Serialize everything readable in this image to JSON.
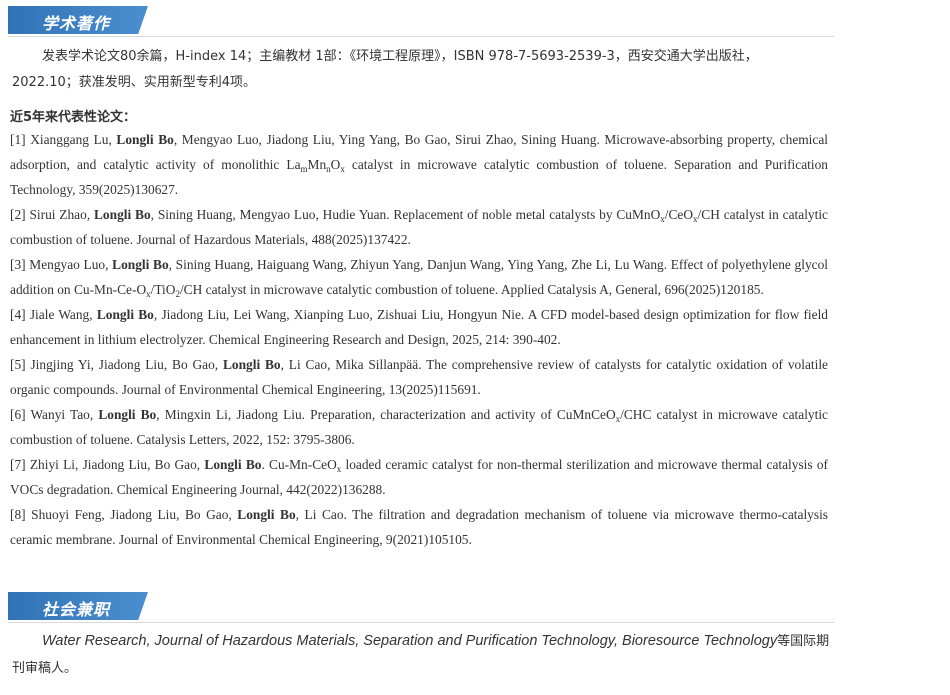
{
  "sections": {
    "academic": {
      "title": "学术著作"
    },
    "social": {
      "title": "社会兼职"
    }
  },
  "intro": "发表学术论文80余篇，H-index 14；主编教材 1部：《环境工程原理》，ISBN 978-7-5693-2539-3，西安交通大学出版社，2022.10；获准发明、实用新型专利4项。",
  "publications_heading": "近5年来代表性论文：",
  "publications": [
    {
      "num": "[1] ",
      "authors_before": "Xianggang Lu, ",
      "highlight": "Longli Bo",
      "segments": [
        {
          "t": ", Mengyao Luo, Jiadong Liu, Ying Yang, Bo Gao, Sirui Zhao, Sining Huang. Microwave-absorbing property, chemical adsorption, and catalytic activity of monolithic La"
        },
        {
          "sub": "m"
        },
        {
          "t": "Mn"
        },
        {
          "sub": "n"
        },
        {
          "t": "O"
        },
        {
          "sub": "x"
        },
        {
          "t": " catalyst in microwave catalytic combustion of toluene. Separation and Purification Technology, 359(2025)130627."
        }
      ]
    },
    {
      "num": "[2] ",
      "authors_before": "Sirui Zhao, ",
      "highlight": "Longli Bo",
      "segments": [
        {
          "t": ", Sining Huang, Mengyao Luo, Hudie Yuan. Replacement of noble metal catalysts by CuMnO"
        },
        {
          "sub": "x"
        },
        {
          "t": "/CeO"
        },
        {
          "sub": "x"
        },
        {
          "t": "/CH catalyst in catalytic combustion of toluene. Journal of Hazardous Materials, 488(2025)137422."
        }
      ]
    },
    {
      "num": "[3] ",
      "authors_before": "Mengyao Luo, ",
      "highlight": "Longli Bo",
      "segments": [
        {
          "t": ", Sining Huang, Haiguang Wang, Zhiyun Yang, Danjun Wang, Ying Yang, Zhe Li, Lu Wang. Effect of polyethylene glycol addition on Cu-Mn-Ce-O"
        },
        {
          "sub": "x"
        },
        {
          "t": "/TiO"
        },
        {
          "sub": "2"
        },
        {
          "t": "/CH catalyst in microwave catalytic combustion of toluene. Applied Catalysis A, General, 696(2025)120185."
        }
      ]
    },
    {
      "num": "[4] ",
      "authors_before": "Jiale Wang, ",
      "highlight": "Longli Bo",
      "segments": [
        {
          "t": ", Jiadong Liu, Lei Wang, Xianping Luo, Zishuai Liu, Hongyun Nie. A CFD model-based design optimization for flow field enhancement in lithium electrolyzer. Chemical Engineering Research and Design, 2025, 214: 390-402."
        }
      ]
    },
    {
      "num": "[5] ",
      "authors_before": "Jingjing Yi, Jiadong Liu, Bo Gao, ",
      "highlight": "Longli Bo",
      "segments": [
        {
          "t": ", Li Cao, Mika Sillanpää. The comprehensive review of catalysts for catalytic oxidation of volatile organic compounds. Journal of Environmental Chemical Engineering, 13(2025)115691."
        }
      ]
    },
    {
      "num": "[6] ",
      "authors_before": "Wanyi Tao, ",
      "highlight": "Longli Bo",
      "segments": [
        {
          "t": ", Mingxin Li, Jiadong Liu. Preparation, characterization and activity of CuMnCeO"
        },
        {
          "sub": "x"
        },
        {
          "t": "/CHC catalyst in microwave catalytic combustion of toluene. Catalysis Letters, 2022, 152: 3795-3806."
        }
      ]
    },
    {
      "num": "[7] ",
      "authors_before": "Zhiyi Li, Jiadong Liu, Bo Gao, ",
      "highlight": "Longli Bo",
      "segments": [
        {
          "t": ". Cu-Mn-CeO"
        },
        {
          "sub": "x"
        },
        {
          "t": " loaded ceramic catalyst for non-thermal sterilization and microwave thermal catalysis of VOCs degradation. Chemical Engineering Journal, 442(2022)136288."
        }
      ]
    },
    {
      "num": "[8] ",
      "authors_before": "Shuoyi Feng, Jiadong Liu, Bo Gao, ",
      "highlight": "Longli Bo",
      "segments": [
        {
          "t": ", Li Cao. The filtration and degradation mechanism of toluene via microwave thermo-catalysis ceramic membrane. Journal of Environmental Chemical Engineering, 9(2021)105105."
        }
      ]
    }
  ],
  "reviewer": {
    "journals": "Water Research, Journal of Hazardous Materials, Separation and Purification Technology, Bioresource Technology",
    "suffix": "等国际期刊审稿人。"
  },
  "colors": {
    "accent": "#3a7fc4",
    "text": "#333333",
    "divider": "#d9d9d9"
  }
}
